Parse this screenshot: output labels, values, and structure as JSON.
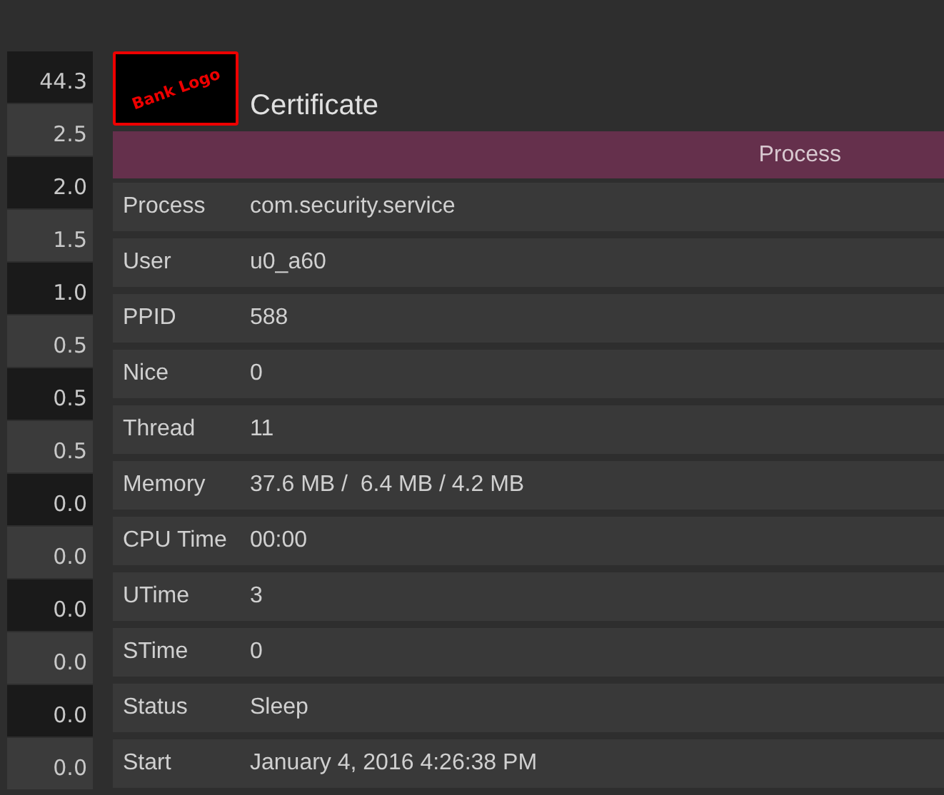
{
  "sidebar": {
    "values": [
      "44.3",
      "2.5",
      "2.0",
      "1.5",
      "1.0",
      "0.5",
      "0.5",
      "0.5",
      "0.0",
      "0.0",
      "0.0",
      "0.0",
      "0.0",
      "0.0"
    ]
  },
  "logo": {
    "text": "Bank Logo"
  },
  "title": "Certificate",
  "header": {
    "title": "Process"
  },
  "details": [
    {
      "label": "Process",
      "value": "com.security.service"
    },
    {
      "label": "User",
      "value": "u0_a60"
    },
    {
      "label": "PPID",
      "value": "588"
    },
    {
      "label": "Nice",
      "value": "0"
    },
    {
      "label": "Thread",
      "value": "11"
    },
    {
      "label": "Memory",
      "value": "37.6 MB /  6.4 MB / 4.2 MB"
    },
    {
      "label": "CPU Time",
      "value": "00:00"
    },
    {
      "label": "UTime",
      "value": "3"
    },
    {
      "label": "STime",
      "value": "0"
    },
    {
      "label": "Status",
      "value": "Sleep"
    },
    {
      "label": "Start",
      "value": "January 4, 2016 4:26:38 PM"
    }
  ]
}
